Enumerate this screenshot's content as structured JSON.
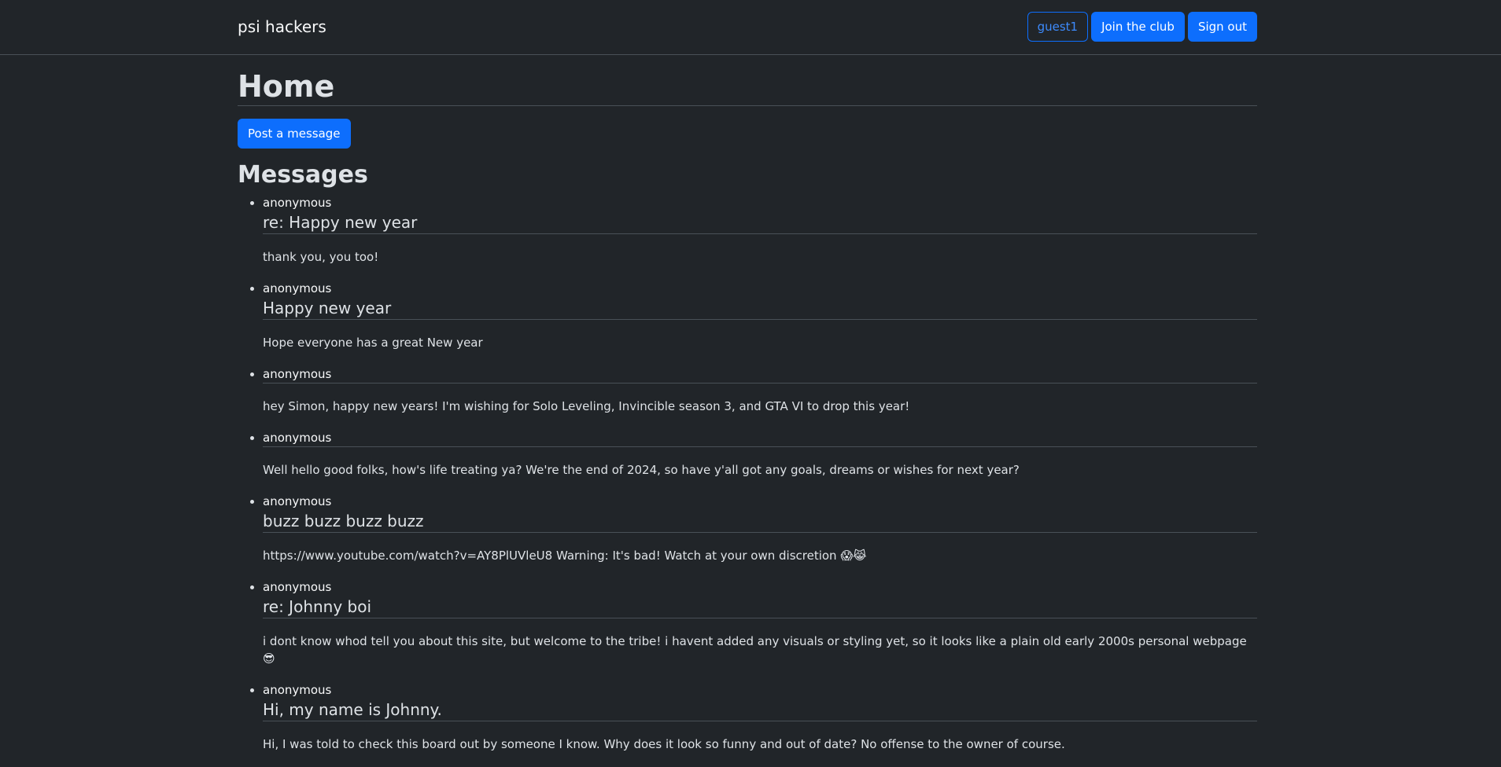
{
  "navbar": {
    "brand": "psi hackers",
    "user_label": "guest1",
    "join_label": "Join the club",
    "signout_label": "Sign out"
  },
  "main": {
    "title": "Home",
    "post_label": "Post a message",
    "messages_heading": "Messages",
    "messages": [
      {
        "author": "anonymous",
        "title": "re: Happy new year",
        "body": "thank you, you too!"
      },
      {
        "author": "anonymous",
        "title": "Happy new year",
        "body": "Hope everyone has a great New year"
      },
      {
        "author": "anonymous",
        "title": "",
        "body": "hey Simon, happy new years! I'm wishing for Solo Leveling, Invincible season 3, and GTA VI to drop this year!"
      },
      {
        "author": "anonymous",
        "title": "",
        "body": "Well hello good folks, how's life treating ya? We're the end of 2024, so have y'all got any goals, dreams or wishes for next year?"
      },
      {
        "author": "anonymous",
        "title": "buzz buzz buzz buzz",
        "body": "https://www.youtube.com/watch?v=AY8PlUVleU8 Warning: It's bad! Watch at your own discretion 😱😹"
      },
      {
        "author": "anonymous",
        "title": "re: Johnny boi",
        "body": "i dont know whod tell you about this site, but welcome to the tribe! i havent added any visuals or styling yet, so it looks like a plain old early 2000s personal webpage 😎"
      },
      {
        "author": "anonymous",
        "title": "Hi, my name is Johnny.",
        "body": "Hi, I was told to check this board out by someone I know. Why does it look so funny and out of date? No offense to the owner of course."
      }
    ]
  }
}
